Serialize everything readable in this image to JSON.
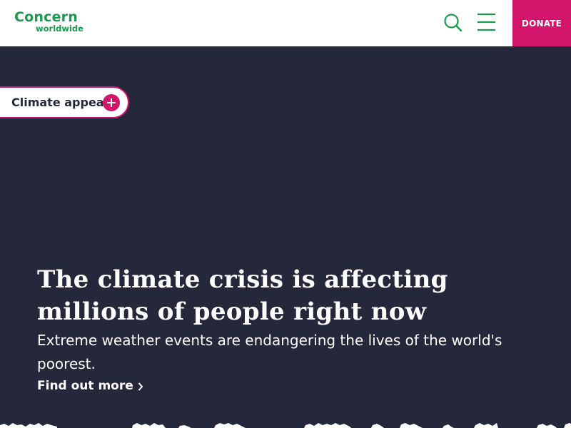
{
  "header": {
    "logo_line1": "Concern",
    "logo_line2": "worldwide",
    "search_icon": "search-icon",
    "menu_icon": "hamburger-menu-icon",
    "donate_label": "DONATE"
  },
  "hero": {
    "appeal_label": "Climate appeal",
    "appeal_icon": "plus-circle-icon",
    "title": "The climate crisis is affecting millions of people right now",
    "subtitle": "Extreme weather events are endangering the lives of the world's poorest.",
    "link_label": "Find out more",
    "link_icon": "chevron-right-icon"
  },
  "colors": {
    "brand_green": "#1b9a4f",
    "accent_pink": "#d3146b",
    "hero_bg": "#24283a",
    "header_bg": "#ffffff"
  }
}
